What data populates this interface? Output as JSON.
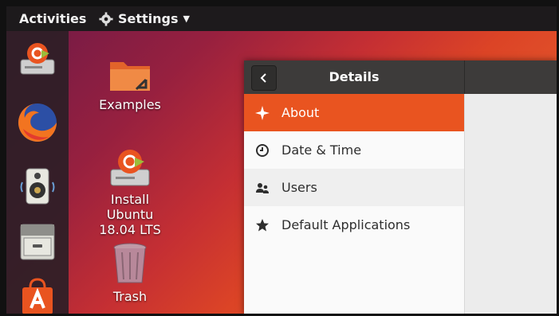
{
  "topbar": {
    "activities": "Activities",
    "app_menu": "Settings"
  },
  "desktop": {
    "icons": [
      {
        "label": "Examples"
      },
      {
        "label": "Install\nUbuntu\n18.04 LTS"
      },
      {
        "label": "Trash"
      }
    ]
  },
  "dock": {
    "items": [
      "install-ubuntu-icon",
      "firefox-icon",
      "rhythmbox-icon",
      "files-icon",
      "software-icon"
    ]
  },
  "window": {
    "title": "Details",
    "sidebar": [
      {
        "label": "About",
        "icon": "sparkle-icon",
        "active": true
      },
      {
        "label": "Date & Time",
        "icon": "clock-icon"
      },
      {
        "label": "Users",
        "icon": "users-icon"
      },
      {
        "label": "Default Applications",
        "icon": "star-icon"
      }
    ]
  },
  "colors": {
    "accent": "#e95420",
    "topbar": "#1d1a1c",
    "headerbar": "#3d3b3a"
  }
}
